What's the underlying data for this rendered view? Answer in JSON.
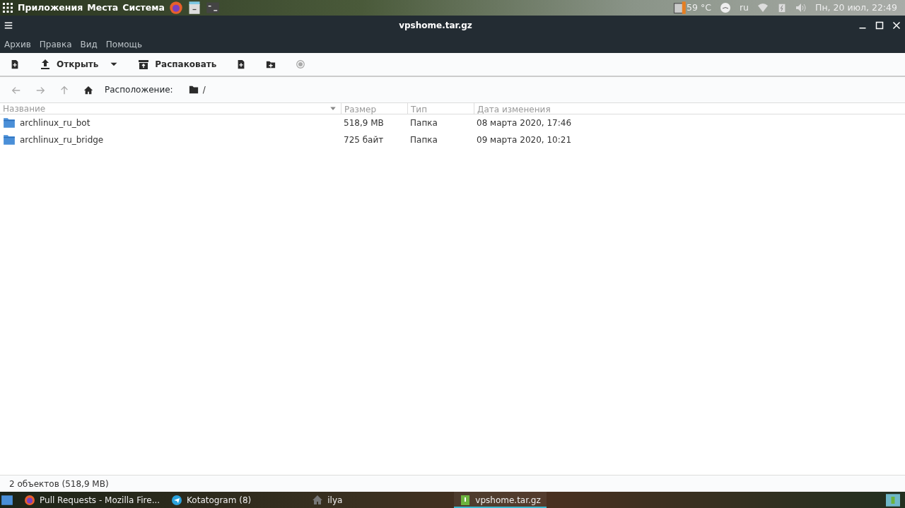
{
  "top_panel": {
    "menus": [
      "Приложения",
      "Места",
      "Система"
    ],
    "temperature": "59 °C",
    "keyboard_layout": "ru",
    "clock": "Пн, 20 июл, 22:49"
  },
  "window": {
    "title": "vpshome.tar.gz"
  },
  "menu_bar": [
    "Архив",
    "Правка",
    "Вид",
    "Помощь"
  ],
  "toolbar": [
    {
      "kind": "icon"
    },
    {
      "kind": "text",
      "label": "Открыть"
    },
    {
      "kind": "dropdown"
    },
    {
      "kind": "text",
      "label": "Распаковать"
    },
    {
      "kind": "icon"
    },
    {
      "kind": "icon"
    },
    {
      "kind": "icon"
    }
  ],
  "location": {
    "label": "Расположение:",
    "path": "/"
  },
  "table": {
    "columns": [
      "Название",
      "Размер",
      "Тип",
      "Дата изменения"
    ],
    "rows": [
      {
        "name": "archlinux_ru_bot",
        "size": "518,9 MB",
        "type": "Папка",
        "modified": "08 марта 2020, 17:46"
      },
      {
        "name": "archlinux_ru_bridge",
        "size": "725 байт",
        "type": "Папка",
        "modified": "09 марта 2020, 10:21"
      }
    ]
  },
  "status_bar": "2 объектов (518,9 MB)",
  "taskbar": [
    {
      "label": "Pull Requests - Mozilla Fire...",
      "selected": false
    },
    {
      "label": "Kotatogram (8)",
      "selected": false
    },
    {
      "label": "ilya",
      "selected": false
    },
    {
      "label": "vpshome.tar.gz",
      "selected": true
    }
  ]
}
